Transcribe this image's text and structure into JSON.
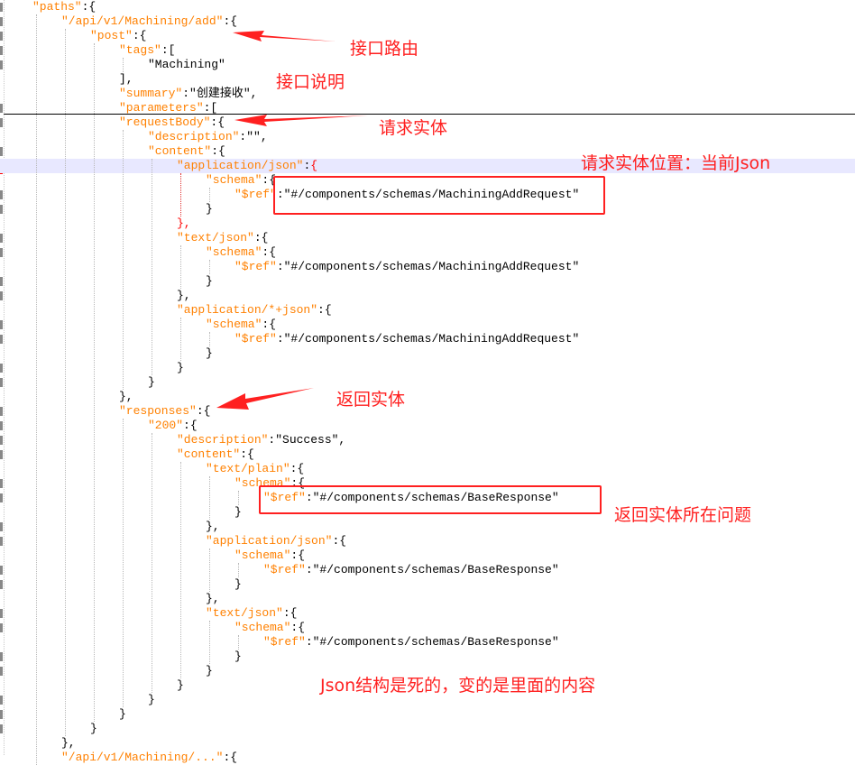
{
  "code_lines": [
    {
      "indent": 1,
      "key": "\"paths\"",
      "rest": ":{"
    },
    {
      "indent": 2,
      "key": "\"/api/v1/Machining/add\"",
      "rest": ":{"
    },
    {
      "indent": 3,
      "key": "\"post\"",
      "rest": ":{"
    },
    {
      "indent": 4,
      "key": "\"tags\"",
      "rest": ":["
    },
    {
      "indent": 5,
      "key": "",
      "rest": "\"Machining\""
    },
    {
      "indent": 4,
      "key": "",
      "rest": "],"
    },
    {
      "indent": 4,
      "key": "\"summary\"",
      "rest": ":\"创建接收\","
    },
    {
      "indent": 4,
      "key": "\"parameters\"",
      "rest": ":["
    },
    {
      "indent": 4,
      "key": "\"requestBody\"",
      "rest": ":{"
    },
    {
      "indent": 5,
      "key": "\"description\"",
      "rest": ":\"\","
    },
    {
      "indent": 5,
      "key": "\"content\"",
      "rest": ":{"
    },
    {
      "indent": 6,
      "key": "\"application/json\"",
      "rest": ":{",
      "highlight": true,
      "red_brace": true
    },
    {
      "indent": 7,
      "key": "\"schema\"",
      "rest": ":{"
    },
    {
      "indent": 8,
      "key": "\"$ref\"",
      "rest": ":\"#/components/schemas/MachiningAddRequest\""
    },
    {
      "indent": 7,
      "key": "",
      "rest": "}"
    },
    {
      "indent": 6,
      "key": "",
      "rest": "},",
      "red_brace": true
    },
    {
      "indent": 6,
      "key": "\"text/json\"",
      "rest": ":{"
    },
    {
      "indent": 7,
      "key": "\"schema\"",
      "rest": ":{"
    },
    {
      "indent": 8,
      "key": "\"$ref\"",
      "rest": ":\"#/components/schemas/MachiningAddRequest\""
    },
    {
      "indent": 7,
      "key": "",
      "rest": "}"
    },
    {
      "indent": 6,
      "key": "",
      "rest": "},"
    },
    {
      "indent": 6,
      "key": "\"application/*+json\"",
      "rest": ":{"
    },
    {
      "indent": 7,
      "key": "\"schema\"",
      "rest": ":{"
    },
    {
      "indent": 8,
      "key": "\"$ref\"",
      "rest": ":\"#/components/schemas/MachiningAddRequest\""
    },
    {
      "indent": 7,
      "key": "",
      "rest": "}"
    },
    {
      "indent": 6,
      "key": "",
      "rest": "}"
    },
    {
      "indent": 5,
      "key": "",
      "rest": "}"
    },
    {
      "indent": 4,
      "key": "",
      "rest": "},"
    },
    {
      "indent": 4,
      "key": "\"responses\"",
      "rest": ":{"
    },
    {
      "indent": 5,
      "key": "\"200\"",
      "rest": ":{"
    },
    {
      "indent": 6,
      "key": "\"description\"",
      "rest": ":\"Success\","
    },
    {
      "indent": 6,
      "key": "\"content\"",
      "rest": ":{"
    },
    {
      "indent": 7,
      "key": "\"text/plain\"",
      "rest": ":{"
    },
    {
      "indent": 8,
      "key": "\"schema\"",
      "rest": ":{"
    },
    {
      "indent": 9,
      "key": "\"$ref\"",
      "rest": ":\"#/components/schemas/BaseResponse\""
    },
    {
      "indent": 8,
      "key": "",
      "rest": "}"
    },
    {
      "indent": 7,
      "key": "",
      "rest": "},"
    },
    {
      "indent": 7,
      "key": "\"application/json\"",
      "rest": ":{"
    },
    {
      "indent": 8,
      "key": "\"schema\"",
      "rest": ":{"
    },
    {
      "indent": 9,
      "key": "\"$ref\"",
      "rest": ":\"#/components/schemas/BaseResponse\""
    },
    {
      "indent": 8,
      "key": "",
      "rest": "}"
    },
    {
      "indent": 7,
      "key": "",
      "rest": "},"
    },
    {
      "indent": 7,
      "key": "\"text/json\"",
      "rest": ":{"
    },
    {
      "indent": 8,
      "key": "\"schema\"",
      "rest": ":{"
    },
    {
      "indent": 9,
      "key": "\"$ref\"",
      "rest": ":\"#/components/schemas/BaseResponse\""
    },
    {
      "indent": 8,
      "key": "",
      "rest": "}"
    },
    {
      "indent": 7,
      "key": "",
      "rest": "}"
    },
    {
      "indent": 6,
      "key": "",
      "rest": "}"
    },
    {
      "indent": 5,
      "key": "",
      "rest": "}"
    },
    {
      "indent": 4,
      "key": "",
      "rest": "}"
    },
    {
      "indent": 3,
      "key": "",
      "rest": "}"
    },
    {
      "indent": 2,
      "key": "",
      "rest": "},"
    },
    {
      "indent": 2,
      "key": "\"/api/v1/Machining/...\"",
      "rest": ":{",
      "partial": true
    }
  ],
  "annotations": {
    "interface_route": "接口路由",
    "interface_description": "接口说明",
    "request_entity": "请求实体",
    "request_entity_location": "请求实体位置：当前Json",
    "response_entity": "返回实体",
    "response_entity_location": "返回实体所在问题",
    "json_structure_note": "Json结构是死的，变的是里面的内容"
  },
  "colors": {
    "key": "#ff8000",
    "annotation": "#ff2020",
    "highlight_line": "#e8e8ff"
  }
}
